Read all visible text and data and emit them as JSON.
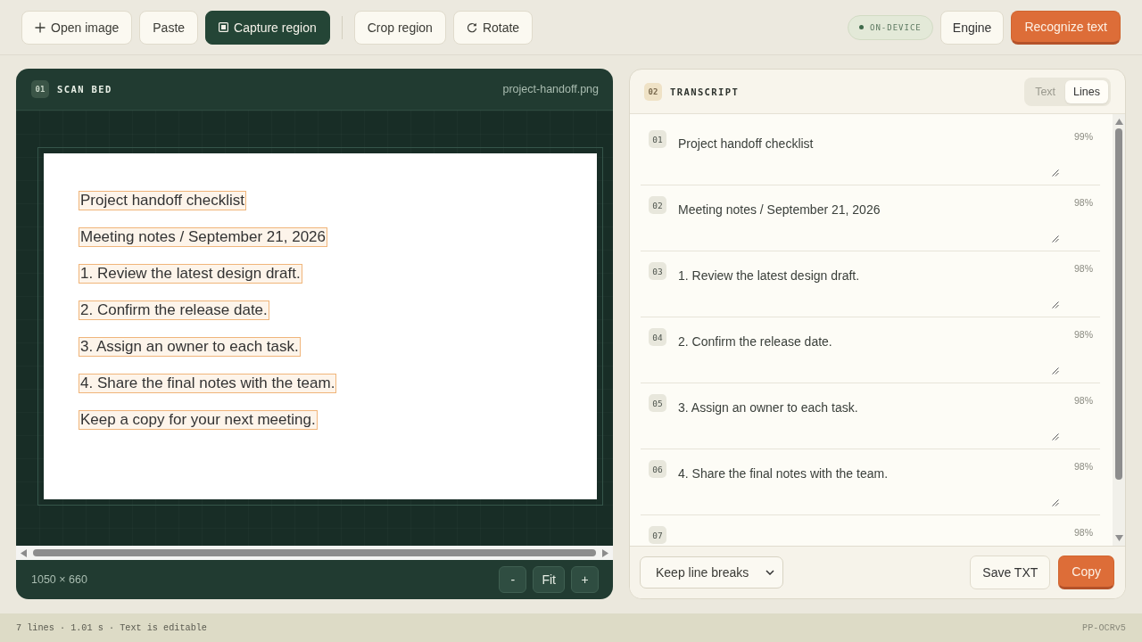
{
  "toolbar": {
    "groups": [
      [
        {
          "kind": "add",
          "label": "Open image",
          "selected": false
        },
        {
          "kind": "plain",
          "label": "Paste",
          "selected": false
        },
        {
          "kind": "capture",
          "label": "Capture region",
          "selected": true
        }
      ],
      [
        {
          "kind": "plain",
          "label": "Crop region",
          "selected": false
        },
        {
          "kind": "rotate",
          "label": "Rotate",
          "selected": false
        }
      ]
    ],
    "engine_badge": "ON-DEVICE",
    "actions": [
      {
        "kind": "secondary",
        "label": "Engine"
      },
      {
        "kind": "primary",
        "label": "Recognize text"
      }
    ]
  },
  "scan_bed": {
    "number": "01",
    "title": "SCAN BED",
    "file_name": "project-handoff.png",
    "page_lines": [
      "Project handoff checklist",
      "Meeting notes / September 21, 2026",
      "1. Review the latest design draft.",
      "2. Confirm the release date.",
      "3. Assign an owner to each task.",
      "4. Share the final notes with the team.",
      "Keep a copy for your next meeting."
    ],
    "dimensions": "1050 × 660",
    "zoom_buttons": [
      "-",
      "Fit",
      "+"
    ]
  },
  "transcript": {
    "number": "02",
    "title": "TRANSCRIPT",
    "view_tabs": [
      {
        "label": "Text",
        "selected": false
      },
      {
        "label": "Lines",
        "selected": true
      }
    ],
    "lines": [
      {
        "number": "01",
        "text": "Project handoff checklist",
        "confidence": "99%"
      },
      {
        "number": "02",
        "text": "Meeting notes / September 21, 2026",
        "confidence": "98%"
      },
      {
        "number": "03",
        "text": "1. Review the latest design draft.",
        "confidence": "98%"
      },
      {
        "number": "04",
        "text": "2. Confirm the release date.",
        "confidence": "98%"
      },
      {
        "number": "05",
        "text": "3. Assign an owner to each task.",
        "confidence": "98%"
      },
      {
        "number": "06",
        "text": "4. Share the final notes with the team.",
        "confidence": "98%"
      },
      {
        "number": "07",
        "confidence": "98%"
      }
    ],
    "line_break_mode": "Keep line breaks",
    "buttons": [
      {
        "kind": "secondary",
        "label": "Save TXT"
      },
      {
        "kind": "primary",
        "label": "Copy"
      }
    ]
  },
  "status_bar": {
    "summary": "7 lines · 1.01 s · Text is editable",
    "model": "PP-OCRv5"
  }
}
